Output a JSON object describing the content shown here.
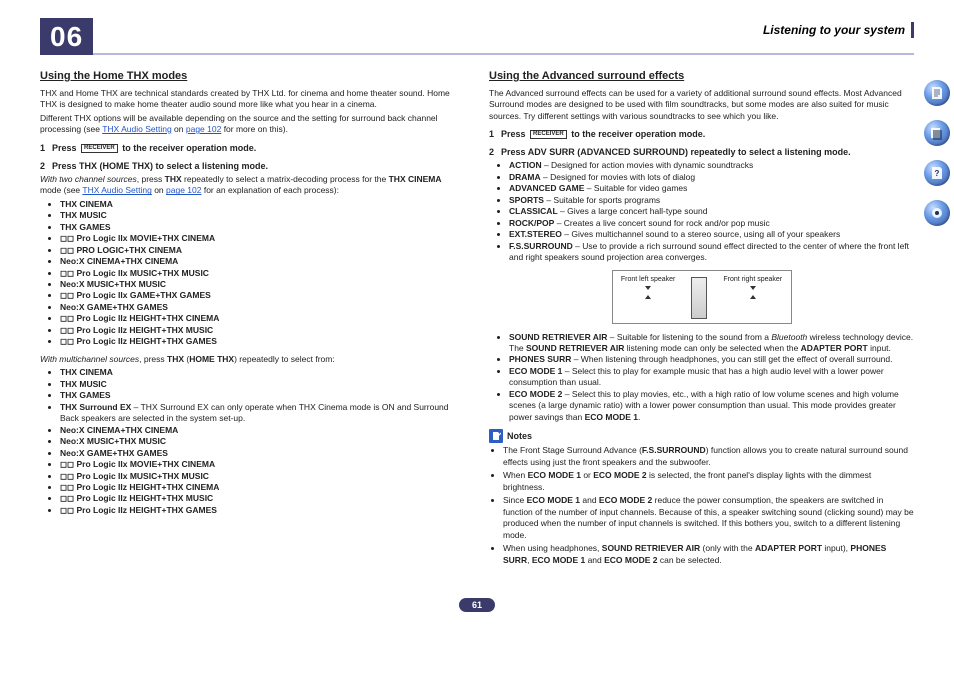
{
  "header": {
    "chapter": "06",
    "title": "Listening to your system"
  },
  "page_number": "61",
  "side_nav": [
    "toc-icon",
    "index-icon",
    "help-icon",
    "settings-icon"
  ],
  "left": {
    "heading": "Using the Home THX modes",
    "intro1": "THX and Home THX are technical standards created by THX Ltd. for cinema and home theater sound. Home THX is designed to make home theater audio sound more like what you hear in a cinema.",
    "intro2_a": "Different THX options will be available depending on the source and the setting for surround back channel processing (see ",
    "intro2_link": "THX Audio Setting",
    "intro2_b": " on ",
    "intro2_link2": "page 102",
    "intro2_c": " for more on this).",
    "step1": "to the receiver operation mode.",
    "step1_prefix": "Press",
    "receiver_label": "RECEIVER",
    "step2": "Press THX (HOME THX) to select a listening mode.",
    "two_ch_lead_a": "With two channel sources",
    "two_ch_lead_b": ", press ",
    "two_ch_lead_c": " repeatedly to select a matrix-decoding process for the ",
    "two_ch_lead_d": " mode (see ",
    "two_ch_lead_link": "THX Audio Setting",
    "two_ch_lead_e": " on ",
    "two_ch_lead_link2": "page 102",
    "two_ch_lead_f": " for an explanation of each process):",
    "THX": "THX",
    "THX_CINEMA": "THX CINEMA",
    "two_ch_list": [
      "THX CINEMA",
      "THX MUSIC",
      "THX GAMES",
      "◻◻ Pro Logic IIx MOVIE+THX CINEMA",
      "◻◻ PRO LOGIC+THX CINEMA",
      "Neo:X CINEMA+THX CINEMA",
      "◻◻ Pro Logic IIx MUSIC+THX MUSIC",
      "Neo:X MUSIC+THX MUSIC",
      "◻◻ Pro Logic IIx GAME+THX GAMES",
      "Neo:X GAME+THX GAMES",
      "◻◻ Pro Logic IIz HEIGHT+THX CINEMA",
      "◻◻ Pro Logic IIz HEIGHT+THX MUSIC",
      "◻◻ Pro Logic IIz HEIGHT+THX GAMES"
    ],
    "multi_lead_a": "With multichannel sources",
    "multi_lead_b": ", press ",
    "multi_lead_c": " (",
    "multi_lead_d": ") repeatedly to select from:",
    "HOME_THX": "HOME THX",
    "multi_list": [
      "THX CINEMA",
      "THX MUSIC",
      "THX GAMES",
      {
        "name": "THX Surround EX",
        "desc": " – THX Surround EX can only operate when THX Cinema mode is ON and Surround Back speakers are selected in the system set-up."
      },
      "Neo:X CINEMA+THX CINEMA",
      "Neo:X MUSIC+THX MUSIC",
      "Neo:X GAME+THX GAMES",
      "◻◻ Pro Logic IIx MOVIE+THX CINEMA",
      "◻◻ Pro Logic IIx MUSIC+THX MUSIC",
      "◻◻ Pro Logic IIz HEIGHT+THX CINEMA",
      "◻◻ Pro Logic IIz HEIGHT+THX MUSIC",
      "◻◻ Pro Logic IIz HEIGHT+THX GAMES"
    ]
  },
  "right": {
    "heading": "Using the Advanced surround effects",
    "intro": "The Advanced surround effects can be used for a variety of additional surround sound effects. Most Advanced Surround modes are designed to be used with film soundtracks, but some modes are also suited for music sources. Try different settings with various soundtracks to see which you like.",
    "step1_prefix": "Press",
    "step1": "to the receiver operation mode.",
    "step2": "Press ADV SURR (ADVANCED SURROUND) repeatedly to select a listening mode.",
    "modes1": [
      {
        "name": "ACTION",
        "desc": " – Designed for action movies with dynamic soundtracks"
      },
      {
        "name": "DRAMA",
        "desc": " – Designed for movies with lots of dialog"
      },
      {
        "name": "ADVANCED GAME",
        "desc": " – Suitable for video games"
      },
      {
        "name": "SPORTS",
        "desc": " – Suitable for sports programs"
      },
      {
        "name": "CLASSICAL",
        "desc": " – Gives a large concert hall-type sound"
      },
      {
        "name": "ROCK/POP",
        "desc": " – Creates a live concert sound for rock and/or pop music"
      },
      {
        "name": "EXT.STEREO",
        "desc": " – Gives multichannel sound to a stereo source, using all of your speakers"
      },
      {
        "name": "F.S.SURROUND",
        "desc": " – Use to provide a rich surround sound effect directed to the center of where the front left and right speakers sound projection area converges."
      }
    ],
    "speaker_labels": {
      "left": "Front left speaker",
      "right": "Front right speaker"
    },
    "modes2": [
      {
        "name": "SOUND RETRIEVER AIR",
        "desc_a": " – Suitable for listening to the sound from a ",
        "desc_i": "Bluetooth",
        "desc_b": " wireless technology device. The ",
        "desc_bold": "SOUND RETRIEVER AIR",
        "desc_c": " listening mode can only be selected when the ",
        "desc_bold2": "ADAPTER PORT",
        "desc_d": " input."
      },
      {
        "name": "PHONES SURR",
        "desc": " – When listening through headphones, you can still get the effect of overall surround."
      },
      {
        "name": "ECO MODE 1",
        "desc": " – Select this to play for example music that has a high audio level with a lower power consumption than usual."
      },
      {
        "name": "ECO MODE 2",
        "desc_a": " – Select this to play movies, etc., with a high ratio of low volume scenes and high volume scenes (a large dynamic ratio) with a lower power consumption than usual. This mode provides greater power savings than ",
        "desc_bold": "ECO MODE 1",
        "desc_b": "."
      }
    ],
    "notes_label": "Notes",
    "notes": [
      {
        "t": "The Front Stage Surround Advance (",
        "b1": "F.S.SURROUND",
        "t2": ") function allows you to create natural surround sound effects using just the front speakers and the subwoofer."
      },
      {
        "t": "When ",
        "b1": "ECO MODE 1",
        "t2": " or ",
        "b2": "ECO MODE 2",
        "t3": " is selected, the front panel's display lights with the dimmest brightness."
      },
      {
        "t": "Since ",
        "b1": "ECO MODE 1",
        "t2": " and ",
        "b2": "ECO MODE 2",
        "t3": " reduce the power consumption, the speakers are switched in function of the number of input channels. Because of this, a speaker switching sound (clicking sound) may be produced when the number of input channels is switched. If this bothers you, switch to a different listening mode."
      },
      {
        "t": "When using headphones, ",
        "b1": "SOUND RETRIEVER AIR",
        "t2": " (only with the ",
        "b2": "ADAPTER PORT",
        "t3": " input), ",
        "b3": "PHONES SURR",
        "t4": ", ",
        "b4": "ECO MODE 1",
        "t5": " and ",
        "b5": "ECO MODE 2",
        "t6": " can be selected."
      }
    ]
  }
}
